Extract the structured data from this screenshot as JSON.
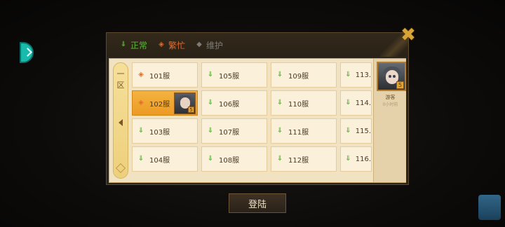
{
  "legend": [
    {
      "label": "正常",
      "status": "ok",
      "icon": "down-arrow-icon",
      "color": "#5cb83a"
    },
    {
      "label": "繁忙",
      "status": "busy",
      "icon": "diamond-dot-icon",
      "color": "#e36a2c"
    },
    {
      "label": "维护",
      "status": "maint",
      "icon": "diamond-icon",
      "color": "#7d7b76"
    }
  ],
  "zone": {
    "label_line1": "一",
    "label_line2": "区"
  },
  "servers": [
    {
      "name": "101服",
      "status": "busy"
    },
    {
      "name": "102服",
      "status": "busy",
      "selected": true
    },
    {
      "name": "103服",
      "status": "ok"
    },
    {
      "name": "104服",
      "status": "ok"
    },
    {
      "name": "105服",
      "status": "ok"
    },
    {
      "name": "106服",
      "status": "ok"
    },
    {
      "name": "107服",
      "status": "ok"
    },
    {
      "name": "108服",
      "status": "ok"
    },
    {
      "name": "109服",
      "status": "ok"
    },
    {
      "name": "110服",
      "status": "ok"
    },
    {
      "name": "111服",
      "status": "ok"
    },
    {
      "name": "112服",
      "status": "ok"
    },
    {
      "name": "113.",
      "status": "ok"
    },
    {
      "name": "114.",
      "status": "ok"
    },
    {
      "name": "115.",
      "status": "ok"
    },
    {
      "name": "116.",
      "status": "ok"
    }
  ],
  "character": {
    "name": "游客",
    "subtitle": "0小时前",
    "badge": "5"
  },
  "mini_badge": "5",
  "login_label": "登陆",
  "close_symbol": "✖",
  "colors": {
    "selected": "#ec9b24",
    "accent": "#d9a437",
    "teal": "#19b9ab"
  }
}
